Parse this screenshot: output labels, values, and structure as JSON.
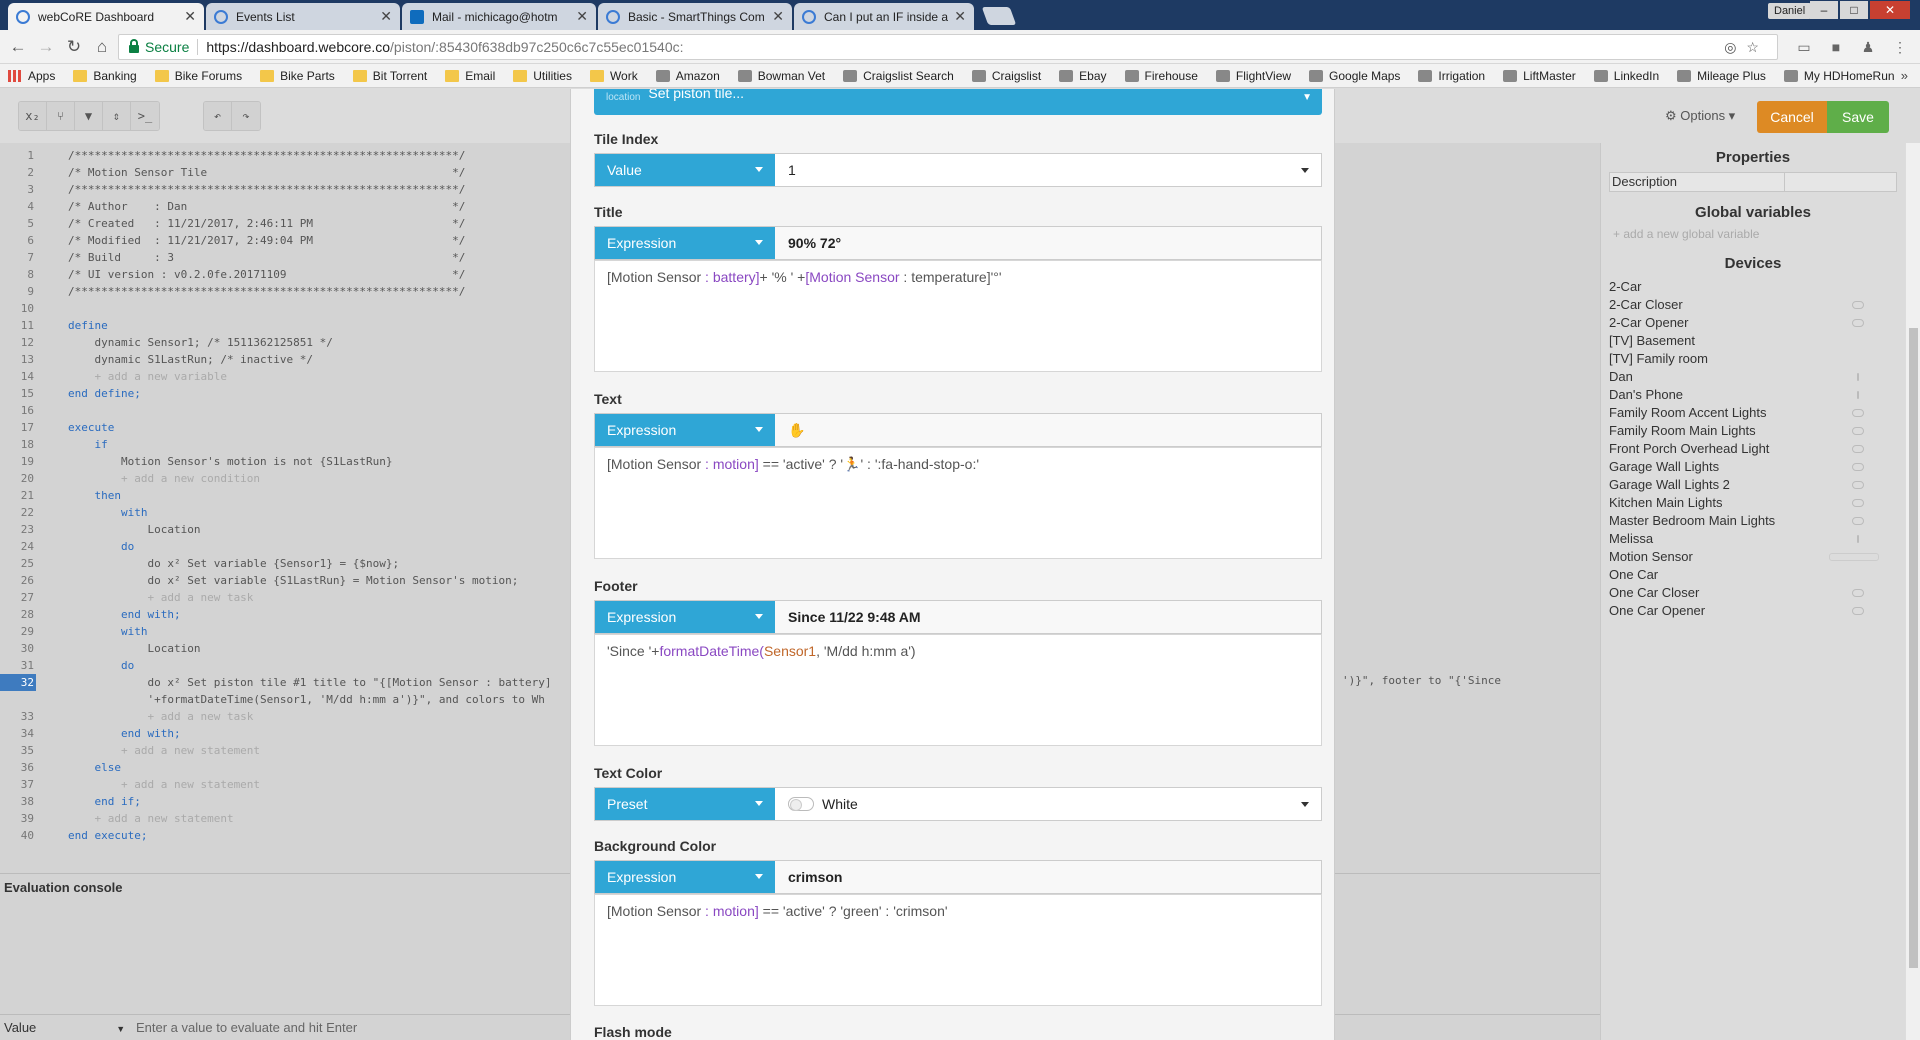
{
  "browser": {
    "tabs": [
      {
        "title": "webCoRE Dashboard"
      },
      {
        "title": "Events List"
      },
      {
        "title": "Mail - michicago@hotm"
      },
      {
        "title": "Basic - SmartThings Com"
      },
      {
        "title": "Can I put an IF inside a W"
      }
    ],
    "user": "Daniel",
    "secure_label": "Secure",
    "url_host": "https://dashboard.webcore.co",
    "url_path": "/piston/:85430f638db97c250c6c7c55ec01540c:",
    "bookmarks": [
      "Apps",
      "Banking",
      "Bike Forums",
      "Bike Parts",
      "Bit Torrent",
      "Email",
      "Utilities",
      "Work",
      "Amazon",
      "Bowman Vet",
      "Craigslist Search",
      "Craigslist",
      "Ebay",
      "Firehouse",
      "FlightView",
      "Google Maps",
      "Irrigation",
      "LiftMaster",
      "LinkedIn",
      "Mileage Plus",
      "My HDHomeRun"
    ]
  },
  "app": {
    "options_label": "⚙ Options ▾",
    "cancel_label": "Cancel",
    "save_label": "Save",
    "code_lines": [
      "/**********************************************************/",
      "/* Motion Sensor Tile                                     */",
      "/**********************************************************/",
      "/* Author    : Dan                                        */",
      "/* Created   : 11/21/2017, 2:46:11 PM                     */",
      "/* Modified  : 11/21/2017, 2:49:04 PM                     */",
      "/* Build     : 3                                          */",
      "/* UI version : v0.2.0fe.20171109                         */",
      "/**********************************************************/",
      "",
      "define",
      "    dynamic Sensor1; /* 1511362125851 */",
      "    dynamic S1LastRun; /* inactive */",
      "    + add a new variable",
      "end define;",
      "",
      "execute",
      "    if",
      "        Motion Sensor's motion is not {S1LastRun}",
      "        + add a new condition",
      "    then",
      "        with",
      "            Location",
      "        do",
      "            do x² Set variable {Sensor1} = {$now};",
      "            do x² Set variable {S1LastRun} = Motion Sensor's motion;",
      "            + add a new task",
      "        end with;",
      "        with",
      "            Location",
      "        do",
      "            do x² Set piston tile #1 title to \"{[Motion Sensor : battery]",
      "            '+formatDateTime(Sensor1, 'M/dd h:mm a')}\", and colors to Wh",
      "            + add a new task",
      "        end with;",
      "        + add a new statement",
      "    else",
      "        + add a new statement",
      "    end if;",
      "    + add a new statement",
      "end execute;"
    ],
    "line_numbers": [
      "1",
      "2",
      "3",
      "4",
      "5",
      "6",
      "7",
      "8",
      "9",
      "10",
      "11",
      "12",
      "13",
      "14",
      "15",
      "16",
      "17",
      "18",
      "19",
      "20",
      "21",
      "22",
      "23",
      "24",
      "25",
      "26",
      "27",
      "28",
      "29",
      "30",
      "31",
      "32",
      "",
      "33",
      "34",
      "35",
      "36",
      "37",
      "38",
      "39",
      "40"
    ],
    "line32_overflow": "')}\", footer to \"{'Since",
    "eval": {
      "title": "Evaluation console",
      "mode": "Value",
      "placeholder": "Enter a value to evaluate and hit Enter"
    },
    "properties": {
      "title": "Properties",
      "description_label": "Description",
      "globals_title": "Global variables",
      "add_global": "+ add a new global variable",
      "devices_title": "Devices",
      "devices": [
        "2-Car",
        "2-Car Closer",
        "2-Car Opener",
        "[TV] Basement",
        "[TV] Family room",
        "Dan",
        "Dan's Phone",
        "Family Room Accent Lights",
        "Family Room Main Lights",
        "Front Porch Overhead Light",
        "Garage Wall Lights",
        "Garage Wall Lights 2",
        "Kitchen Main Lights",
        "Master Bedroom Main Lights",
        "Melissa",
        "Motion Sensor",
        "One Car",
        "One Car Closer",
        "One Car Opener"
      ]
    }
  },
  "modal": {
    "header_location": "location",
    "header_action": "Set piston tile...",
    "tile_index": {
      "label": "Tile Index",
      "mode": "Value",
      "value": "1"
    },
    "title": {
      "label": "Title",
      "mode": "Expression",
      "value": "90% 72°",
      "expr_a": "[Motion Sensor",
      "expr_b": " : ",
      "expr_c": "battery]",
      "expr_d": "+ '%    ' +",
      "expr_e": "[Motion Sensor",
      "expr_f": " : temperature]'°'"
    },
    "text": {
      "label": "Text",
      "mode": "Expression",
      "value": "✋",
      "expr_a": "[Motion Sensor",
      "expr_b": " : ",
      "expr_c": "motion]",
      "expr_d": " == 'active' ? '🏃' : ':fa-hand-stop-o:'"
    },
    "footer": {
      "label": "Footer",
      "mode": "Expression",
      "value": "Since 11/22 9:48 AM",
      "expr_a": "'Since '+",
      "expr_b": "formatDateTime(",
      "expr_c": "Sensor1",
      "expr_d": ", 'M/dd h:mm a')"
    },
    "text_color": {
      "label": "Text Color",
      "mode": "Preset",
      "value": "White"
    },
    "background_color": {
      "label": "Background Color",
      "mode": "Expression",
      "value": "crimson",
      "expr_a": "[Motion Sensor",
      "expr_b": " : ",
      "expr_c": "motion]",
      "expr_d": " == 'active' ? 'green' : 'crimson'"
    },
    "flash_mode": {
      "label": "Flash mode"
    }
  }
}
